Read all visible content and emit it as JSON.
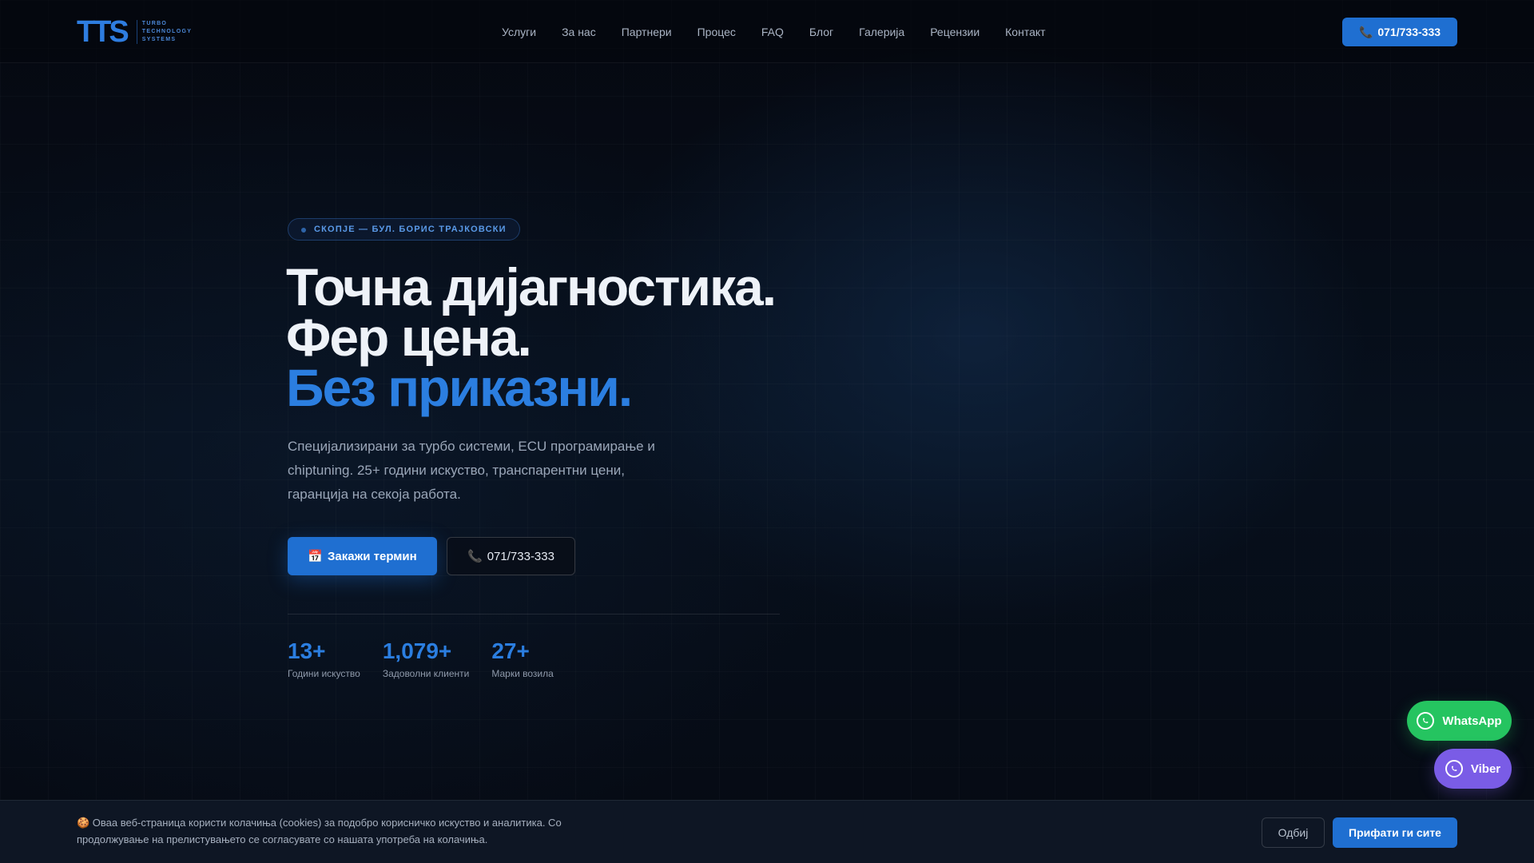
{
  "header": {
    "logo_mark": "TTS",
    "logo_sub": [
      "TURBO",
      "TECHNOLOGY",
      "SYSTEMS"
    ],
    "nav": [
      {
        "label": "Услуги"
      },
      {
        "label": "За нас"
      },
      {
        "label": "Партнери"
      },
      {
        "label": "Процес"
      },
      {
        "label": "FAQ"
      },
      {
        "label": "Блог"
      },
      {
        "label": "Галерија"
      },
      {
        "label": "Рецензии"
      },
      {
        "label": "Контакт"
      }
    ],
    "cta_icon": "📞",
    "cta_label": "071/733-333"
  },
  "hero": {
    "badge": "СКОПЈЕ — БУЛ. БОРИС ТРАЈКОВСКИ",
    "headline_1": "Точна дијагностика.",
    "headline_2": "Фер цена.",
    "headline_3": "Без приказни.",
    "lede": "Специјализирани за турбо системи, ECU програмирање и chiptuning. 25+ години искуство, транспарентни цени, гаранција на секоја работа.",
    "primary_icon": "📅",
    "primary_label": "Закажи термин",
    "secondary_icon": "📞",
    "secondary_label": "071/733-333"
  },
  "stats": [
    {
      "value": "13+",
      "label": "Години искуство"
    },
    {
      "value": "1,079+",
      "label": "Задоволни клиенти"
    },
    {
      "value": "27+",
      "label": "Марки возила"
    }
  ],
  "chat": {
    "whatsapp_label": "WhatsApp",
    "viber_label": "Viber"
  },
  "cookie": {
    "text": "🍪 Оваа веб-страница користи колачиња (cookies) за подобро корисничко искуство и аналитика. Со продолжување на прелистувањето се согласувате со нашата употреба на колачиња.",
    "decline_label": "Одбиј",
    "accept_label": "Прифати ги сите"
  },
  "colors": {
    "accent": "#1f6fd1",
    "accent_text": "#2b7ee0",
    "whatsapp": "#25c460",
    "viber": "#7a5ce6",
    "background": "#060a12"
  }
}
